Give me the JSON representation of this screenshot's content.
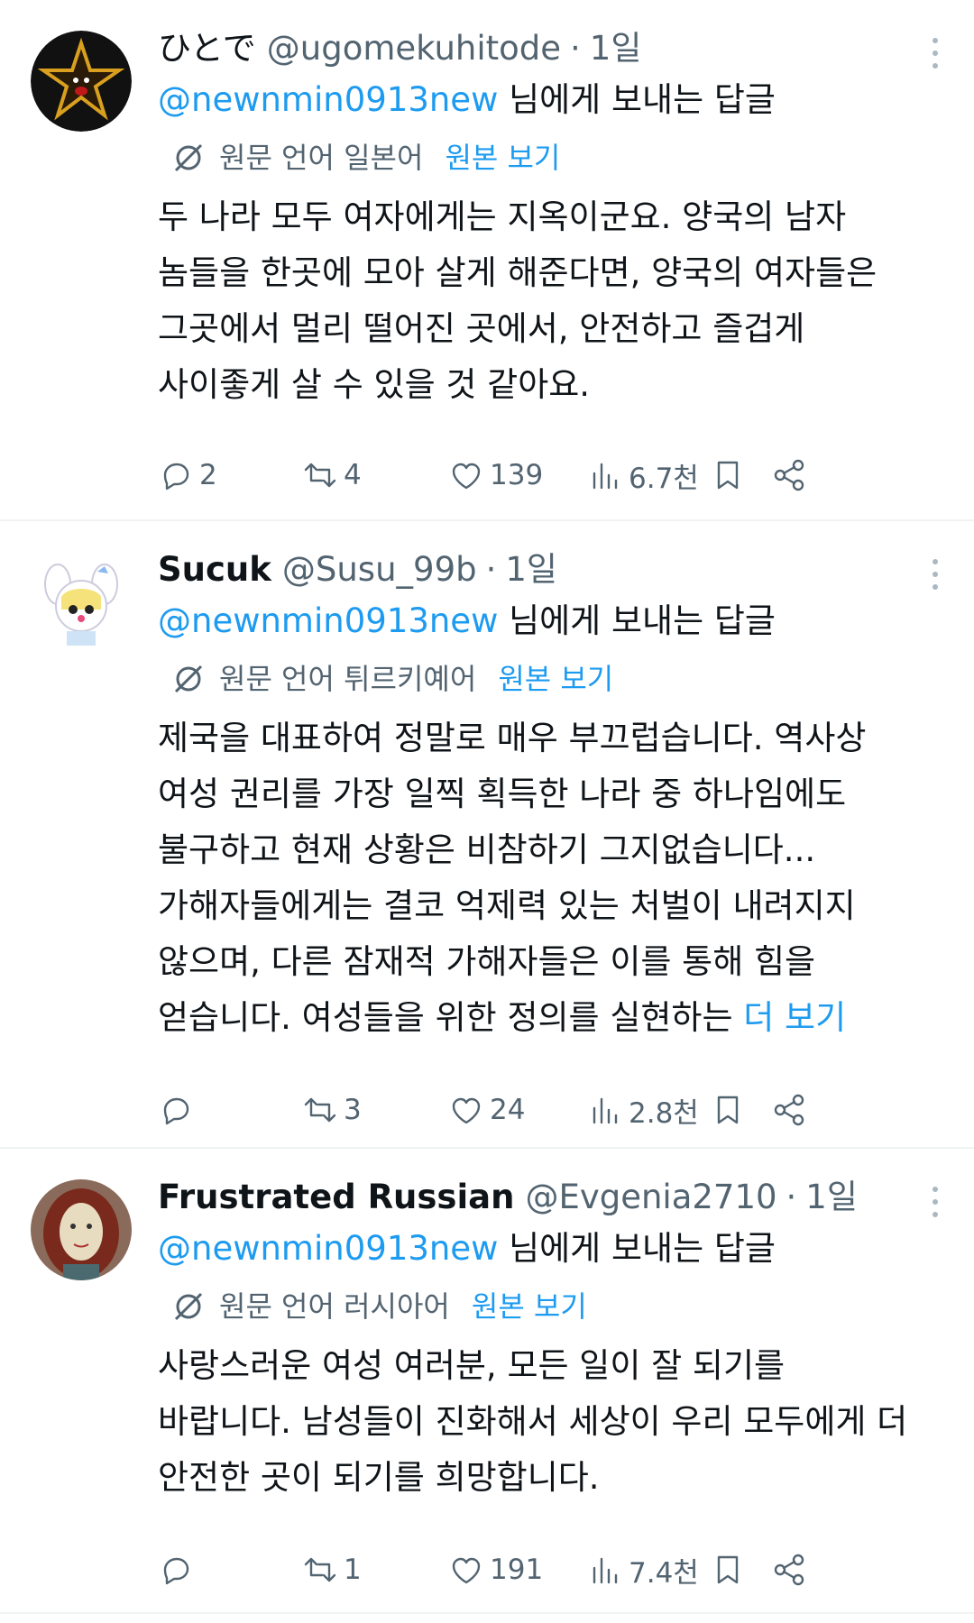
{
  "tweets": [
    {
      "display_name": "ひとで",
      "handle": "@ugomekuhitode",
      "time": "1일",
      "reply_mention": "@newnmin0913new",
      "reply_suffix": " 님에게 보내는 답글",
      "lang_text": "원문 언어 일본어",
      "view_original": "원본 보기",
      "body": [
        "두 나라 모두 여자에게는 지옥이군요. 양국의 남자",
        "놈들을 한곳에 모아 살게 해준다면, 양국의 여자들은",
        "그곳에서 멀리 떨어진 곳에서, 안전하고 즐겁게",
        "사이좋게 살 수 있을 것 같아요."
      ],
      "more_link": "",
      "replies": "2",
      "reposts": "4",
      "likes": "139",
      "views": "6.7천",
      "avatar_icon": "star-avatar"
    },
    {
      "display_name": "Sucuk",
      "handle": "@Susu_99b",
      "time": "1일",
      "reply_mention": "@newnmin0913new",
      "reply_suffix": " 님에게 보내는 답글",
      "lang_text": "원문 언어 튀르키예어",
      "view_original": "원본 보기",
      "body": [
        "제국을 대표하여 정말로 매우 부끄럽습니다. 역사상",
        "여성 권리를 가장 일찍 획득한 나라 중 하나임에도",
        "불구하고 현재 상황은 비참하기 그지없습니다...",
        "가해자들에게는 결코 억제력 있는 처벌이 내려지지",
        "않으며, 다른 잠재적 가해자들은 이를 통해 힘을",
        "얻습니다. 여성들을 위한 정의를 실현하는 "
      ],
      "more_link": "더 보기",
      "replies": "",
      "reposts": "3",
      "likes": "24",
      "views": "2.8천",
      "avatar_icon": "anime-avatar"
    },
    {
      "display_name": "Frustrated Russian",
      "handle": "@Evgenia2710",
      "time": "1일",
      "reply_mention": "@newnmin0913new",
      "reply_suffix": " 님에게 보내는 답글",
      "lang_text": "원문 언어 러시아어",
      "view_original": "원본 보기",
      "body": [
        "사랑스러운 여성 여러분, 모든 일이 잘 되기를",
        "바랍니다. 남성들이 진화해서 세상이 우리 모두에게 더",
        "안전한 곳이 되기를 희망합니다."
      ],
      "more_link": "",
      "replies": "",
      "reposts": "1",
      "likes": "191",
      "views": "7.4천",
      "avatar_icon": "portrait-avatar"
    }
  ],
  "colors": {
    "link": "#1d9bf0",
    "secondary": "#536471",
    "text": "#0f1419",
    "divider": "#eff3f4"
  }
}
